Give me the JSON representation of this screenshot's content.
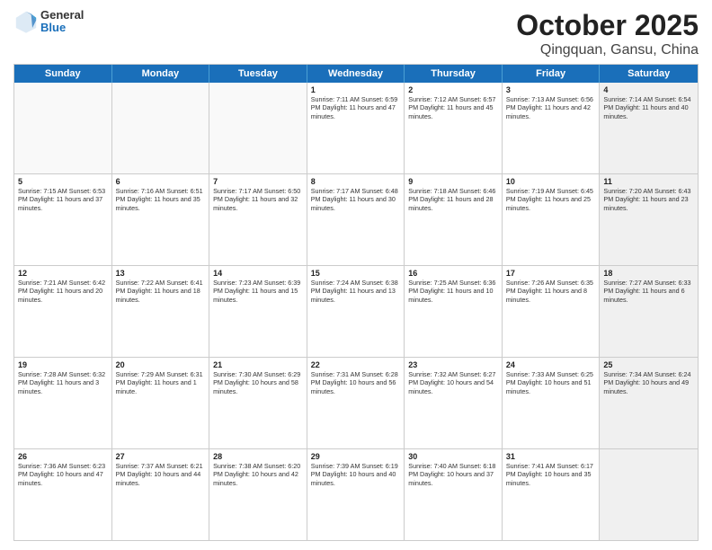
{
  "header": {
    "logo": {
      "general": "General",
      "blue": "Blue"
    },
    "title": "October 2025",
    "subtitle": "Qingquan, Gansu, China"
  },
  "weekdays": [
    "Sunday",
    "Monday",
    "Tuesday",
    "Wednesday",
    "Thursday",
    "Friday",
    "Saturday"
  ],
  "rows": [
    [
      {
        "day": "",
        "text": "",
        "empty": true
      },
      {
        "day": "",
        "text": "",
        "empty": true
      },
      {
        "day": "",
        "text": "",
        "empty": true
      },
      {
        "day": "1",
        "text": "Sunrise: 7:11 AM\nSunset: 6:59 PM\nDaylight: 11 hours and 47 minutes."
      },
      {
        "day": "2",
        "text": "Sunrise: 7:12 AM\nSunset: 6:57 PM\nDaylight: 11 hours and 45 minutes."
      },
      {
        "day": "3",
        "text": "Sunrise: 7:13 AM\nSunset: 6:56 PM\nDaylight: 11 hours and 42 minutes."
      },
      {
        "day": "4",
        "text": "Sunrise: 7:14 AM\nSunset: 6:54 PM\nDaylight: 11 hours and 40 minutes.",
        "shaded": true
      }
    ],
    [
      {
        "day": "5",
        "text": "Sunrise: 7:15 AM\nSunset: 6:53 PM\nDaylight: 11 hours and 37 minutes."
      },
      {
        "day": "6",
        "text": "Sunrise: 7:16 AM\nSunset: 6:51 PM\nDaylight: 11 hours and 35 minutes."
      },
      {
        "day": "7",
        "text": "Sunrise: 7:17 AM\nSunset: 6:50 PM\nDaylight: 11 hours and 32 minutes."
      },
      {
        "day": "8",
        "text": "Sunrise: 7:17 AM\nSunset: 6:48 PM\nDaylight: 11 hours and 30 minutes."
      },
      {
        "day": "9",
        "text": "Sunrise: 7:18 AM\nSunset: 6:46 PM\nDaylight: 11 hours and 28 minutes."
      },
      {
        "day": "10",
        "text": "Sunrise: 7:19 AM\nSunset: 6:45 PM\nDaylight: 11 hours and 25 minutes."
      },
      {
        "day": "11",
        "text": "Sunrise: 7:20 AM\nSunset: 6:43 PM\nDaylight: 11 hours and 23 minutes.",
        "shaded": true
      }
    ],
    [
      {
        "day": "12",
        "text": "Sunrise: 7:21 AM\nSunset: 6:42 PM\nDaylight: 11 hours and 20 minutes."
      },
      {
        "day": "13",
        "text": "Sunrise: 7:22 AM\nSunset: 6:41 PM\nDaylight: 11 hours and 18 minutes."
      },
      {
        "day": "14",
        "text": "Sunrise: 7:23 AM\nSunset: 6:39 PM\nDaylight: 11 hours and 15 minutes."
      },
      {
        "day": "15",
        "text": "Sunrise: 7:24 AM\nSunset: 6:38 PM\nDaylight: 11 hours and 13 minutes."
      },
      {
        "day": "16",
        "text": "Sunrise: 7:25 AM\nSunset: 6:36 PM\nDaylight: 11 hours and 10 minutes."
      },
      {
        "day": "17",
        "text": "Sunrise: 7:26 AM\nSunset: 6:35 PM\nDaylight: 11 hours and 8 minutes."
      },
      {
        "day": "18",
        "text": "Sunrise: 7:27 AM\nSunset: 6:33 PM\nDaylight: 11 hours and 6 minutes.",
        "shaded": true
      }
    ],
    [
      {
        "day": "19",
        "text": "Sunrise: 7:28 AM\nSunset: 6:32 PM\nDaylight: 11 hours and 3 minutes."
      },
      {
        "day": "20",
        "text": "Sunrise: 7:29 AM\nSunset: 6:31 PM\nDaylight: 11 hours and 1 minute."
      },
      {
        "day": "21",
        "text": "Sunrise: 7:30 AM\nSunset: 6:29 PM\nDaylight: 10 hours and 58 minutes."
      },
      {
        "day": "22",
        "text": "Sunrise: 7:31 AM\nSunset: 6:28 PM\nDaylight: 10 hours and 56 minutes."
      },
      {
        "day": "23",
        "text": "Sunrise: 7:32 AM\nSunset: 6:27 PM\nDaylight: 10 hours and 54 minutes."
      },
      {
        "day": "24",
        "text": "Sunrise: 7:33 AM\nSunset: 6:25 PM\nDaylight: 10 hours and 51 minutes."
      },
      {
        "day": "25",
        "text": "Sunrise: 7:34 AM\nSunset: 6:24 PM\nDaylight: 10 hours and 49 minutes.",
        "shaded": true
      }
    ],
    [
      {
        "day": "26",
        "text": "Sunrise: 7:36 AM\nSunset: 6:23 PM\nDaylight: 10 hours and 47 minutes."
      },
      {
        "day": "27",
        "text": "Sunrise: 7:37 AM\nSunset: 6:21 PM\nDaylight: 10 hours and 44 minutes."
      },
      {
        "day": "28",
        "text": "Sunrise: 7:38 AM\nSunset: 6:20 PM\nDaylight: 10 hours and 42 minutes."
      },
      {
        "day": "29",
        "text": "Sunrise: 7:39 AM\nSunset: 6:19 PM\nDaylight: 10 hours and 40 minutes."
      },
      {
        "day": "30",
        "text": "Sunrise: 7:40 AM\nSunset: 6:18 PM\nDaylight: 10 hours and 37 minutes."
      },
      {
        "day": "31",
        "text": "Sunrise: 7:41 AM\nSunset: 6:17 PM\nDaylight: 10 hours and 35 minutes."
      },
      {
        "day": "",
        "text": "",
        "empty": true,
        "shaded": true
      }
    ]
  ]
}
